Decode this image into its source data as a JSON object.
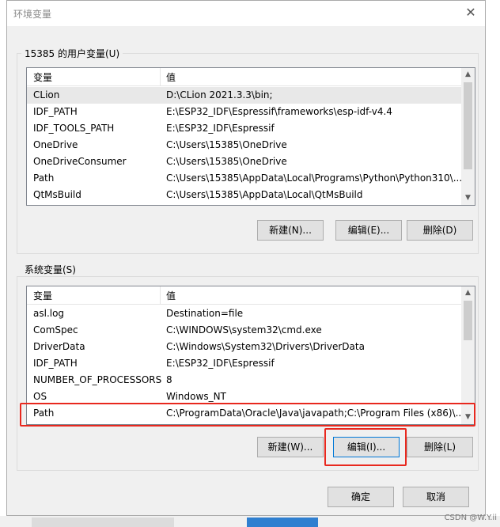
{
  "dialog": {
    "title": "环境变量"
  },
  "user_vars": {
    "label": "15385 的用户变量(U)",
    "col_name": "变量",
    "col_value": "值",
    "rows": [
      {
        "name": "CLion",
        "value": "D:\\CLion 2021.3.3\\bin;"
      },
      {
        "name": "IDF_PATH",
        "value": "E:\\ESP32_IDF\\Espressif\\frameworks\\esp-idf-v4.4"
      },
      {
        "name": "IDF_TOOLS_PATH",
        "value": "E:\\ESP32_IDF\\Espressif"
      },
      {
        "name": "OneDrive",
        "value": "C:\\Users\\15385\\OneDrive"
      },
      {
        "name": "OneDriveConsumer",
        "value": "C:\\Users\\15385\\OneDrive"
      },
      {
        "name": "Path",
        "value": "C:\\Users\\15385\\AppData\\Local\\Programs\\Python\\Python310\\..."
      },
      {
        "name": "QtMsBuild",
        "value": "C:\\Users\\15385\\AppData\\Local\\QtMsBuild"
      }
    ],
    "buttons": {
      "new": "新建(N)...",
      "edit": "编辑(E)...",
      "delete": "删除(D)"
    }
  },
  "system_vars": {
    "label": "系统变量(S)",
    "col_name": "变量",
    "col_value": "值",
    "rows": [
      {
        "name": "asl.log",
        "value": "Destination=file"
      },
      {
        "name": "ComSpec",
        "value": "C:\\WINDOWS\\system32\\cmd.exe"
      },
      {
        "name": "DriverData",
        "value": "C:\\Windows\\System32\\Drivers\\DriverData"
      },
      {
        "name": "IDF_PATH",
        "value": "E:\\ESP32_IDF\\Espressif"
      },
      {
        "name": "NUMBER_OF_PROCESSORS",
        "value": "8"
      },
      {
        "name": "OS",
        "value": "Windows_NT"
      },
      {
        "name": "Path",
        "value": "C:\\ProgramData\\Oracle\\Java\\javapath;C:\\Program Files (x86)\\..."
      }
    ],
    "buttons": {
      "new": "新建(W)...",
      "edit": "编辑(I)...",
      "delete": "删除(L)"
    }
  },
  "footer": {
    "ok": "确定",
    "cancel": "取消"
  },
  "watermark": "CSDN @W.Y.ii",
  "colors": {
    "annotation": "#e8281e",
    "focus": "#0078d7"
  }
}
